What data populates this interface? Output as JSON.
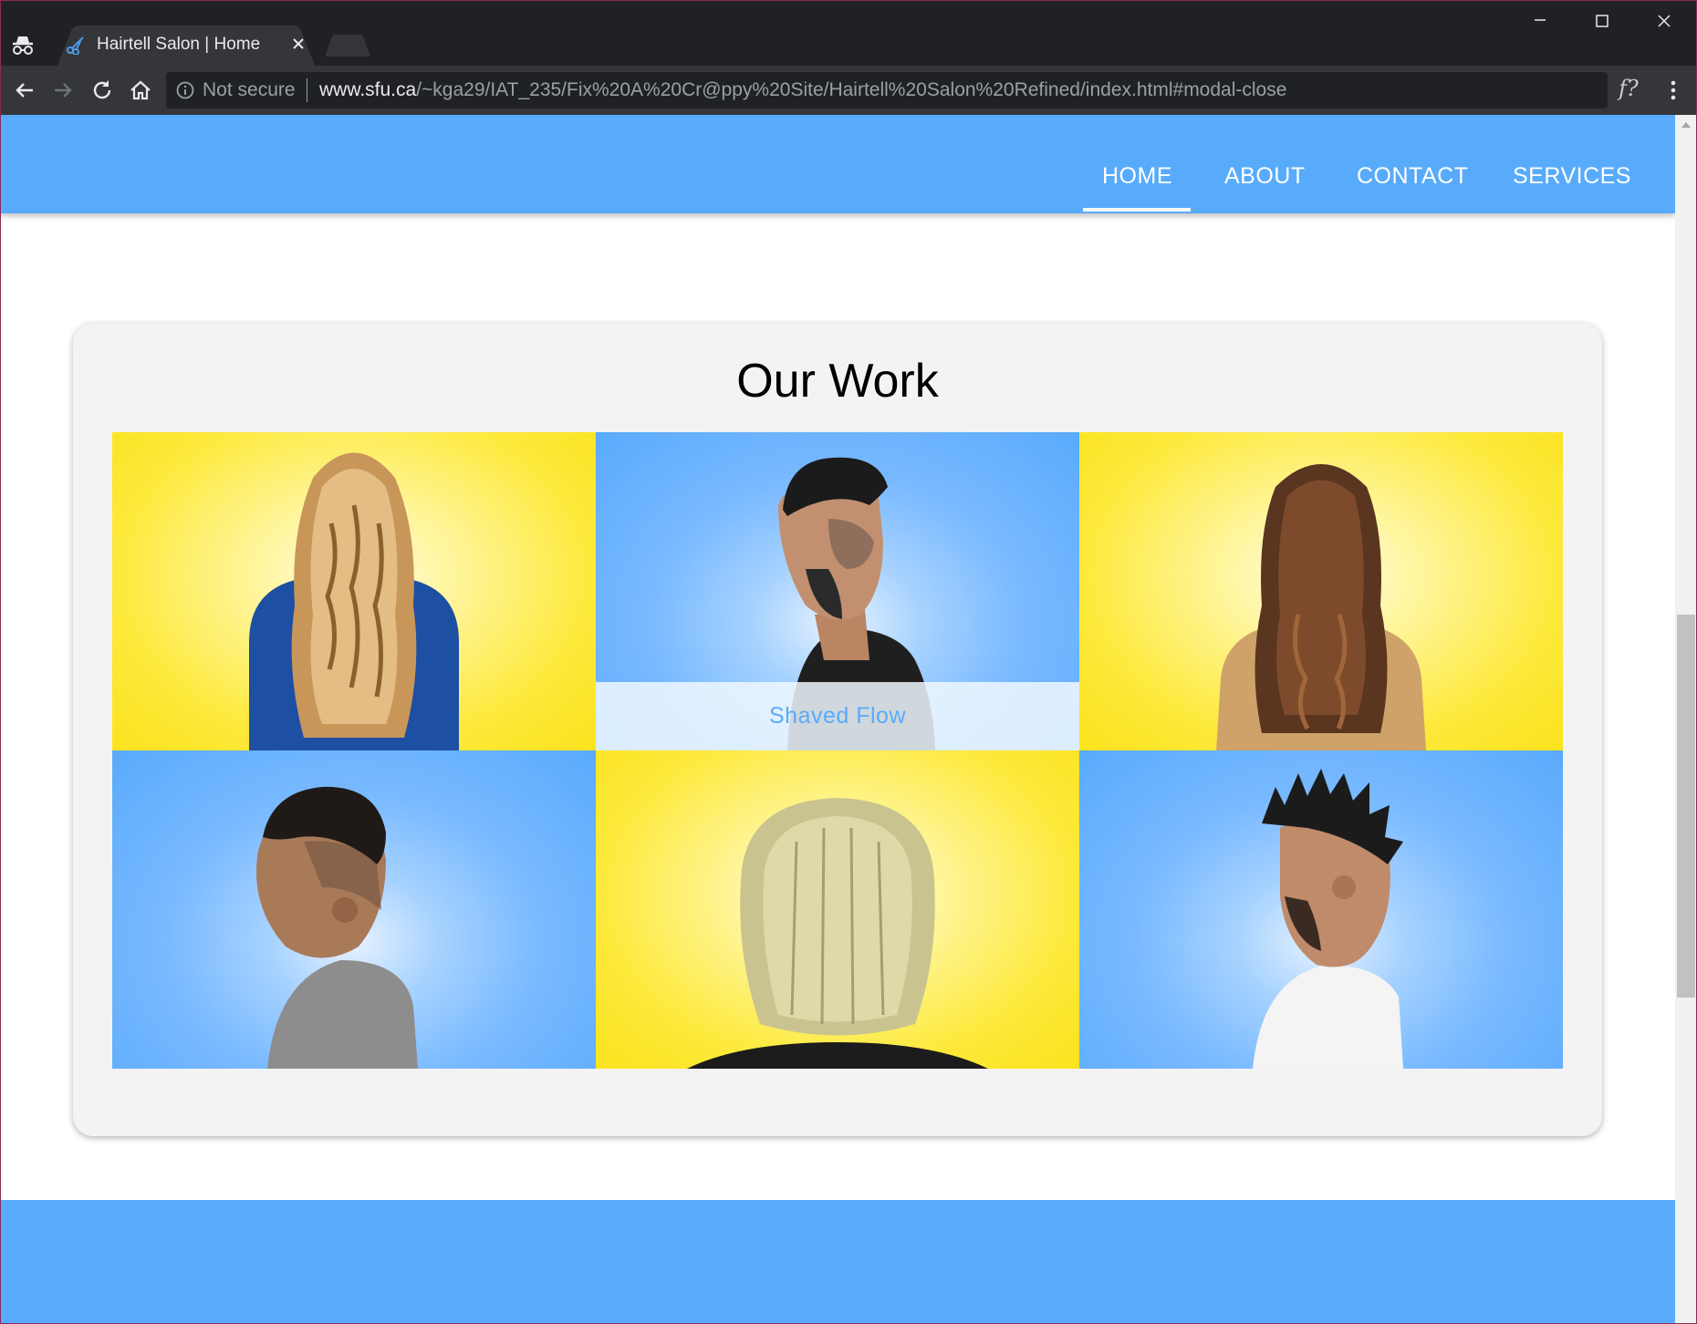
{
  "browser": {
    "tab_title": "Hairtell Salon | Home",
    "security_label": "Not secure",
    "url_host": "www.sfu.ca",
    "url_path": "/~kga29/IAT_235/Fix%20A%20Cr@ppy%20Site/Hairtell%20Salon%20Refined/index.html#modal-close",
    "extension_label": "f?",
    "icons": [
      "incognito-icon",
      "scissors-favicon",
      "close-tab-icon",
      "new-tab-icon",
      "minimize-icon",
      "maximize-icon",
      "close-window-icon",
      "back-icon",
      "forward-icon",
      "reload-icon",
      "home-icon",
      "info-icon",
      "menu-icon"
    ]
  },
  "site": {
    "nav": [
      {
        "label": "HOME",
        "active": true
      },
      {
        "label": "ABOUT",
        "active": false
      },
      {
        "label": "CONTACT",
        "active": false
      },
      {
        "label": "SERVICES",
        "active": false
      }
    ],
    "section_title": "Our Work",
    "gallery": [
      {
        "background": "yellow"
      },
      {
        "background": "blue",
        "caption": "Shaved Flow"
      },
      {
        "background": "yellow"
      },
      {
        "background": "blue"
      },
      {
        "background": "yellow"
      },
      {
        "background": "blue"
      }
    ]
  },
  "colors": {
    "brand_blue": "#58abfb",
    "tile_yellow": "#fde93a",
    "card_bg": "#f3f3f3",
    "chrome_dark": "#202124"
  }
}
